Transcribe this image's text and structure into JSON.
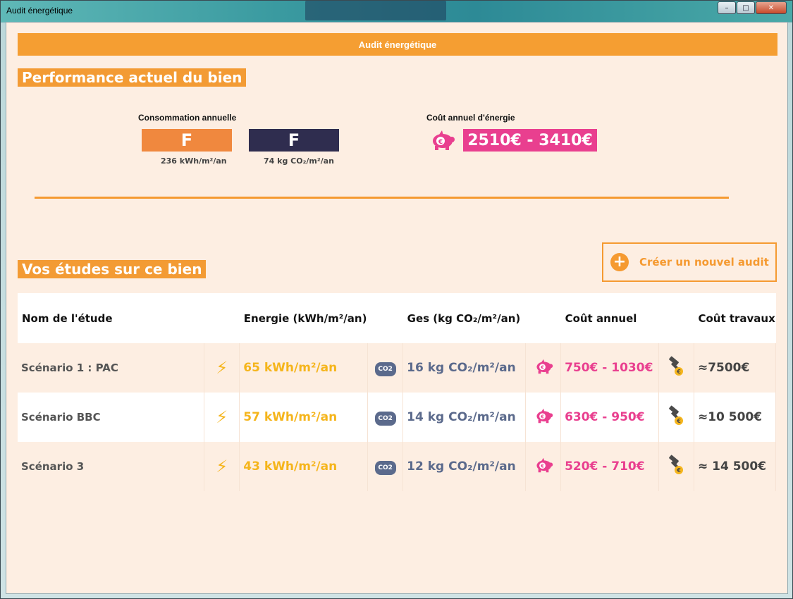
{
  "window": {
    "title": "Audit énergétique",
    "min": "–",
    "max": "□",
    "close": "✕"
  },
  "header": {
    "title": "Audit énergétique"
  },
  "performance": {
    "title": "Performance actuel du bien",
    "consumption_label": "Consommation annuelle",
    "energy_grade": "F",
    "energy_value": "236 kWh/m²/an",
    "ges_grade": "F",
    "ges_value": "74 kg CO₂/m²/an",
    "cost_label": "Coût annuel d'énergie",
    "cost_value": "2510€ - 3410€"
  },
  "studies": {
    "title": "Vos études sur ce bien",
    "new_button": "Créer un nouvel audit",
    "columns": [
      "Nom de l'étude",
      "Energie (kWh/m²/an)",
      "Ges (kg CO₂/m²/an)",
      "Coût annuel",
      "Coût travaux"
    ],
    "rows": [
      {
        "name": "Scénario 1 : PAC",
        "energy": "65 kWh/m²/an",
        "ges": "16 kg CO₂/m²/an",
        "cost": "750€ - 1030€",
        "works": "≈7500€"
      },
      {
        "name": "Scénario BBC",
        "energy": "57 kWh/m²/an",
        "ges": "14 kg CO₂/m²/an",
        "cost": "630€ - 950€",
        "works": "≈10 500€"
      },
      {
        "name": "Scénario 3",
        "energy": "43 kWh/m²/an",
        "ges": "12 kg CO₂/m²/an",
        "cost": "520€ - 710€",
        "works": "≈ 14 500€"
      }
    ]
  },
  "icons": {
    "co2": "CO2",
    "bolt": "⚡",
    "euro": "€",
    "plus": "+"
  },
  "colors": {
    "accent": "#f59a31",
    "pink": "#e93f8f",
    "energy": "#f5b51c",
    "ges": "#5b6a8c",
    "grade_energy": "#f0883e",
    "grade_ges": "#2f2d4f"
  }
}
